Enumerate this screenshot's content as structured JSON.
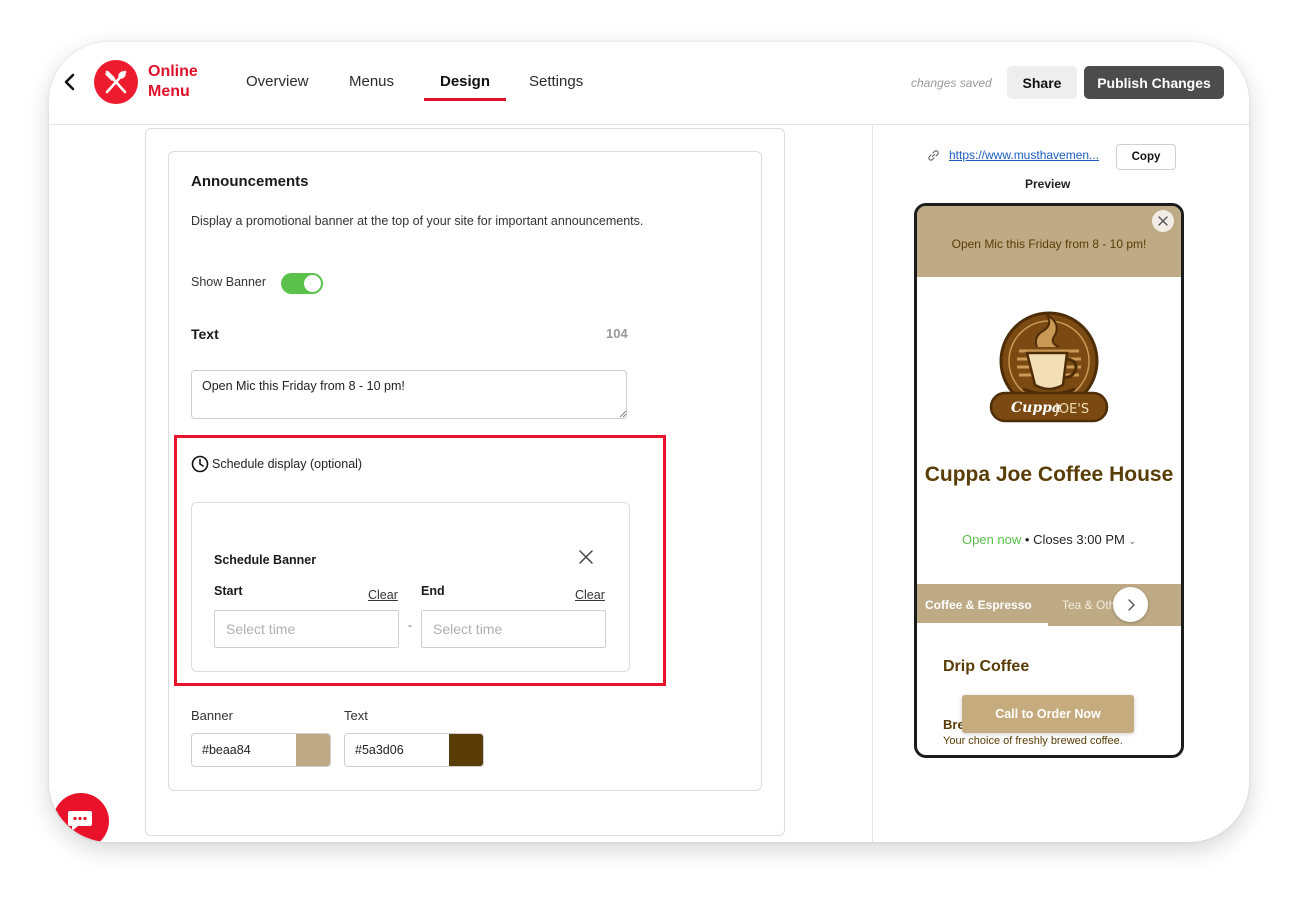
{
  "header": {
    "brand_line1": "Online",
    "brand_line2": "Menu",
    "tabs": [
      {
        "label": "Overview",
        "active": false
      },
      {
        "label": "Menus",
        "active": false
      },
      {
        "label": "Design",
        "active": true
      },
      {
        "label": "Settings",
        "active": false
      }
    ],
    "saved_status": "changes saved",
    "share_label": "Share",
    "publish_label": "Publish Changes"
  },
  "announcements": {
    "title": "Announcements",
    "description": "Display a promotional banner at the top of your site for important announcements.",
    "show_banner_label": "Show Banner",
    "show_banner_on": true,
    "text_label": "Text",
    "char_count": "104",
    "banner_text": "Open Mic this Friday from 8 - 10 pm!",
    "schedule_toggle_label": "Schedule display (optional)",
    "schedule": {
      "title": "Schedule Banner",
      "start_label": "Start",
      "end_label": "End",
      "clear_label": "Clear",
      "placeholder": "Select time",
      "separator": "-"
    },
    "colors": {
      "banner_label": "Banner",
      "banner_value": "#beaa84",
      "text_label": "Text",
      "text_value": "#5a3d06"
    }
  },
  "preview_panel": {
    "url": "https://www.musthavemen...",
    "copy_label": "Copy",
    "preview_label": "Preview",
    "phone": {
      "banner_text": "Open Mic this Friday from 8 - 10 pm!",
      "logo_text_cuppa": "Cuppa",
      "logo_text_joes": "JOE'S",
      "restaurant_name": "Cuppa Joe Coffee House",
      "open_status": "Open now",
      "closes": "Closes 3:00 PM",
      "tabs": [
        "Coffee & Espresso",
        "Tea & Other D"
      ],
      "section_title": "Drip Coffee",
      "item_name": "Bre",
      "item_desc": "Your choice of freshly brewed coffee.",
      "cta_label": "Call to Order Now"
    }
  }
}
